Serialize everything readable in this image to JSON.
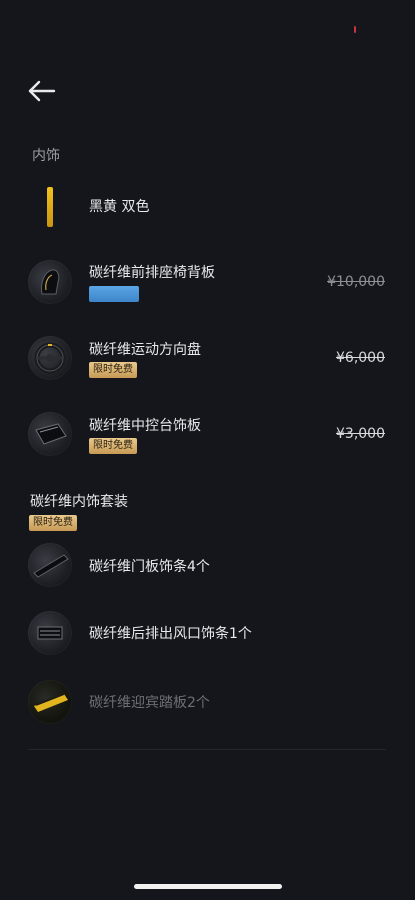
{
  "interior": {
    "section_title": "内饰",
    "color_option": {
      "label": "黑黄 双色",
      "swatch_color": "#e4b21a"
    },
    "items": [
      {
        "label": "碳纤维前排座椅背板",
        "price": "¥10,000"
      },
      {
        "label": "碳纤维运动方向盘",
        "badge": "限时免费",
        "price": "¥6,000"
      },
      {
        "label": "碳纤维中控台饰板",
        "badge": "限时免费",
        "price": "¥3,000"
      }
    ]
  },
  "kit": {
    "title": "碳纤维内饰套装",
    "badge": "限时免费",
    "items": [
      {
        "label": "碳纤维门板饰条4个"
      },
      {
        "label": "碳纤维后排出风口饰条1个"
      },
      {
        "label": "碳纤维迎宾踏板2个"
      }
    ]
  },
  "colors": {
    "background": "#14161b",
    "badge_gold": "#d8b070",
    "selected_blue": "#4a95d8"
  },
  "icons": {
    "back": "arrow-left"
  }
}
